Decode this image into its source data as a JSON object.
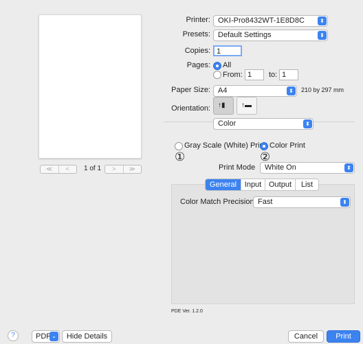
{
  "preview": {
    "page_indicator": "1 of 1",
    "first_glyph": "≪",
    "prev_glyph": "<",
    "next_glyph": ">",
    "last_glyph": "≫"
  },
  "printer": {
    "label": "Printer:",
    "value": "OKI-Pro8432WT-1E8D8C"
  },
  "presets": {
    "label": "Presets:",
    "value": "Default Settings"
  },
  "copies": {
    "label": "Copies:",
    "value": "1"
  },
  "pages": {
    "label": "Pages:",
    "all_label": "All",
    "from_label": "From:",
    "from_value": "1",
    "to_label": "to:",
    "to_value": "1"
  },
  "paper_size": {
    "label": "Paper Size:",
    "value": "A4",
    "dimensions": "210 by 297 mm"
  },
  "orientation": {
    "label": "Orientation:"
  },
  "section_popup": {
    "value": "Color"
  },
  "color": {
    "gray_label": "Gray Scale (White) Print",
    "color_label": "Color Print",
    "marker_1": "①",
    "marker_2": "②",
    "print_mode_label": "Print Mode",
    "print_mode_value": "White On"
  },
  "tabs": [
    "General",
    "Input",
    "Output",
    "List"
  ],
  "general": {
    "precision_label": "Color Match Precision:",
    "precision_value": "Fast"
  },
  "pde_version": "PDE Ver.  1.2.0",
  "footer": {
    "help_glyph": "?",
    "pdf_label": "PDF",
    "hide_details_label": "Hide Details",
    "cancel_label": "Cancel",
    "print_label": "Print"
  },
  "colors": {
    "accent": "#3c83f0",
    "panel": "#e3e3e3"
  }
}
